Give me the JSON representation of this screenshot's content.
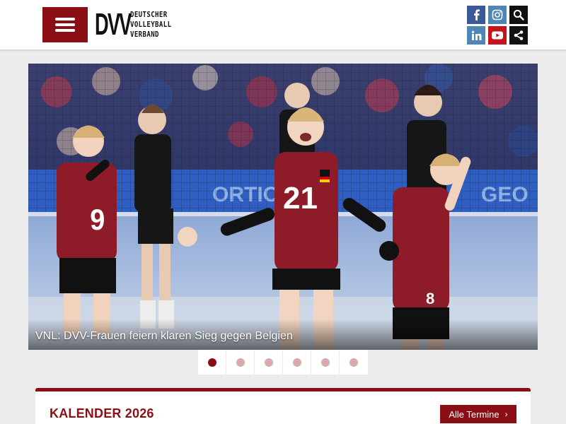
{
  "header": {
    "logo": {
      "mark": "DVV",
      "lines": [
        "DEUTSCHER",
        "VOLLEYBALL",
        "VERBAND"
      ]
    },
    "social_icons": [
      "facebook-icon",
      "instagram-icon",
      "search-icon",
      "linkedin-icon",
      "youtube-icon",
      "share-icon"
    ]
  },
  "hero": {
    "caption": "VNL: DVV-Frauen feiern klaren Sieg gegen Belgien",
    "slide_count": 6,
    "active_slide": 1
  },
  "calendar": {
    "title": "KALENDER 2026",
    "button_label": "Alle Termine",
    "button_icon": "chevron-right-icon"
  },
  "colors": {
    "brand": "#8b0e14",
    "facebook": "#3b5998",
    "instagram": "#4f86b8",
    "linkedin": "#4f86b8",
    "youtube": "#c4151c",
    "dark": "#111111"
  }
}
